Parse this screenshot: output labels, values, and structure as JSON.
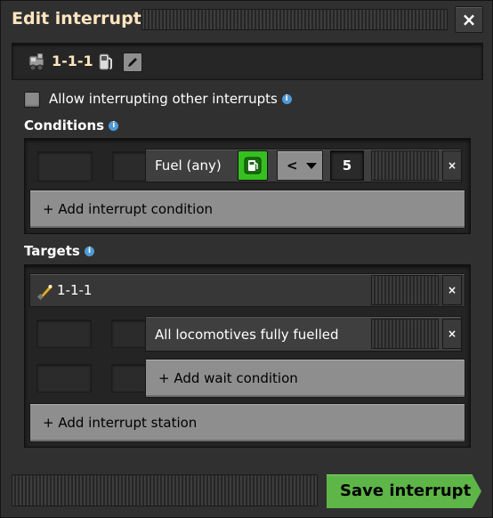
{
  "window": {
    "title": "Edit interrupt",
    "close_label": "×"
  },
  "header": {
    "name": "1-1-1",
    "edit_icon": "pencil-icon",
    "train_icon": "locomotive-icon",
    "fuel_icon": "fuel-pump-icon"
  },
  "options": {
    "allow_interrupting_label": "Allow interrupting other interrupts",
    "allow_interrupting_checked": false,
    "info_symbol": "i"
  },
  "conditions": {
    "label": "Conditions",
    "items": [
      {
        "label": "Fuel (any)",
        "signal_icon": "fuel-signal-icon",
        "comparator": "<",
        "value": "5",
        "remove_label": "×"
      }
    ],
    "add_label": "+ Add interrupt condition"
  },
  "targets": {
    "label": "Targets",
    "stations": [
      {
        "name": "1-1-1",
        "icon": "train-stop-icon",
        "remove_label": "×",
        "wait_conditions": [
          {
            "label": "All locomotives fully fuelled",
            "remove_label": "×"
          }
        ],
        "add_wait_label": "+ Add wait condition"
      }
    ],
    "add_station_label": "+ Add interrupt station"
  },
  "footer": {
    "save_label": "Save interrupt"
  },
  "colors": {
    "title": "#ffe6c0",
    "accent_green": "#5eb548",
    "signal_green": "#36c020",
    "info_blue": "#4f9ad6"
  }
}
